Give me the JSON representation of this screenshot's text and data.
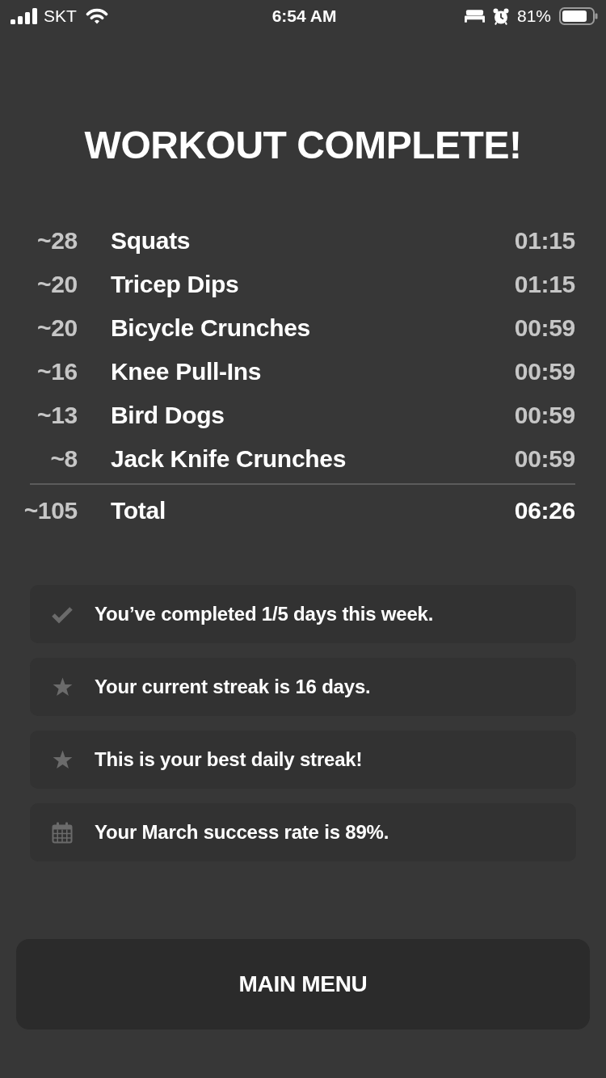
{
  "status_bar": {
    "carrier": "SKT",
    "time": "6:54 AM",
    "battery": "81%"
  },
  "title": "WORKOUT COMPLETE!",
  "exercises": [
    {
      "reps": "~28",
      "name": "Squats",
      "time": "01:15"
    },
    {
      "reps": "~20",
      "name": "Tricep Dips",
      "time": "01:15"
    },
    {
      "reps": "~20",
      "name": "Bicycle Crunches",
      "time": "00:59"
    },
    {
      "reps": "~16",
      "name": "Knee Pull-Ins",
      "time": "00:59"
    },
    {
      "reps": "~13",
      "name": "Bird Dogs",
      "time": "00:59"
    },
    {
      "reps": "~8",
      "name": "Jack Knife Crunches",
      "time": "00:59"
    }
  ],
  "total": {
    "reps": "~105",
    "label": "Total",
    "time": "06:26"
  },
  "stats": [
    {
      "kind": "check",
      "text": "You’ve completed 1/5 days this week."
    },
    {
      "kind": "star",
      "text": "Your current streak is 16 days."
    },
    {
      "kind": "star",
      "text": "This is your best daily streak!"
    },
    {
      "kind": "calendar",
      "text": "Your March success rate is 89%."
    }
  ],
  "button": {
    "label": "MAIN MENU"
  }
}
